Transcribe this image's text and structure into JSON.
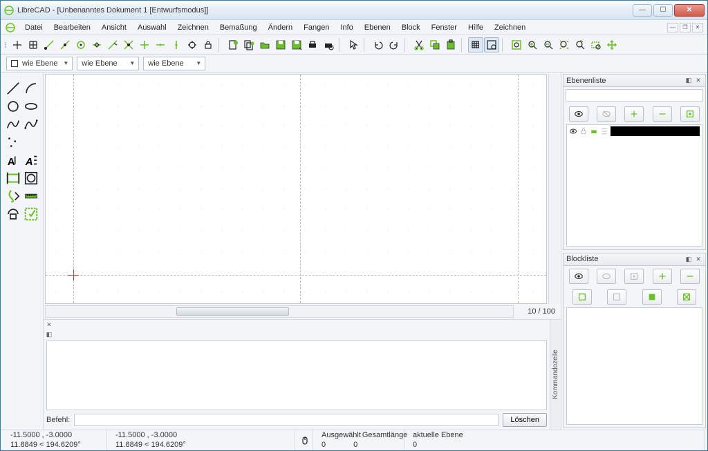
{
  "window_title": "LibreCAD - [Unbenanntes Dokument 1 [Entwurfsmodus]]",
  "menu": {
    "items": [
      "Datei",
      "Bearbeiten",
      "Ansicht",
      "Auswahl",
      "Zeichnen",
      "Bemaßung",
      "Ändern",
      "Fangen",
      "Info",
      "Ebenen",
      "Block",
      "Fenster",
      "Hilfe",
      "Zeichnen"
    ]
  },
  "props": {
    "layer": "wie Ebene",
    "color": "wie Ebene",
    "linetype": "wie Ebene"
  },
  "canvas": {
    "ratio": "10 / 100"
  },
  "command": {
    "panel_label": "Kommandozeile",
    "prompt": "Befehl:",
    "clear": "Löschen"
  },
  "panels": {
    "layers_title": "Ebenenliste",
    "blocks_title": "Blockliste"
  },
  "status": {
    "coord1a": "-11.5000 , -3.0000",
    "coord1b": "11.8849 < 194.6209°",
    "coord2a": "-11.5000 , -3.0000",
    "coord2b": "11.8849 < 194.6209°",
    "sel_label": "Ausgewählt",
    "len_label": "Gesamtlänge",
    "sel_val": "0",
    "len_val": "0",
    "layer_label": "aktuelle Ebene",
    "layer_val": "0"
  }
}
